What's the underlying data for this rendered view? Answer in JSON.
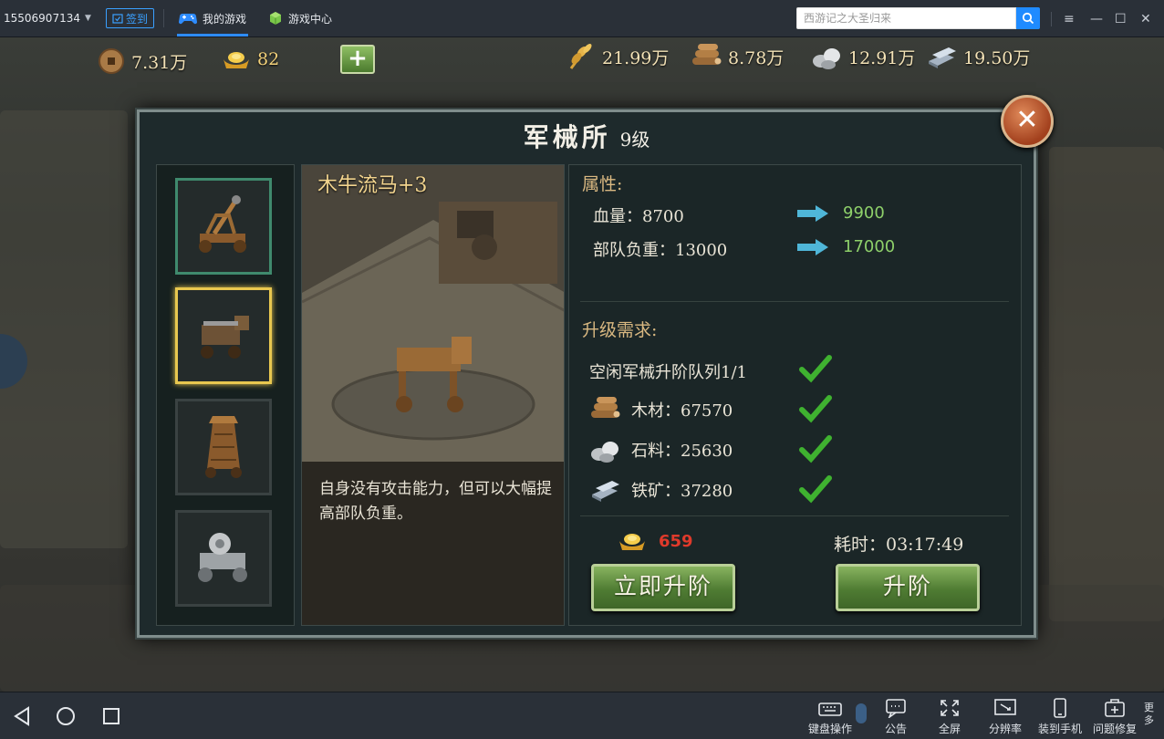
{
  "topbar": {
    "user": "15506907134",
    "checkin": "签到",
    "tabs": [
      {
        "label": "我的游戏"
      },
      {
        "label": "游戏中心"
      }
    ],
    "search_placeholder": "西游记之大圣归来"
  },
  "resources": {
    "copper": "7.31万",
    "ingot": "82",
    "grain": "21.99万",
    "wood": "8.78万",
    "stone": "12.91万",
    "iron": "19.50万"
  },
  "panel": {
    "title": "军械所",
    "level": "9级",
    "item_name": "木牛流马+3",
    "description": "自身没有攻击能力，但可以大幅提高部队负重。",
    "attributes_header": "属性:",
    "attributes": [
      {
        "label": "血量：8700",
        "next": "9900"
      },
      {
        "label": "部队负重：13000",
        "next": "17000"
      }
    ],
    "requirements_header": "升级需求:",
    "requirements": [
      {
        "label": "空闲军械升阶队列1/1"
      },
      {
        "label": "木材：67570",
        "icon": "wood-icon"
      },
      {
        "label": "石料：25630",
        "icon": "stone-icon"
      },
      {
        "label": "铁矿：37280",
        "icon": "iron-icon"
      }
    ],
    "ingot_cost": "659",
    "time": "耗时：03:17:49",
    "instant_button": "立即升阶",
    "upgrade_button": "升阶"
  },
  "bottombar": {
    "tools": [
      {
        "label": "键盘操作"
      },
      {
        "label": "公告"
      },
      {
        "label": "全屏"
      },
      {
        "label": "分辨率"
      },
      {
        "label": "装到手机"
      },
      {
        "label": "问题修复"
      }
    ],
    "more": "更多"
  },
  "colors": {
    "accent": "#1f8bff",
    "highlight_gold": "#e8c74f",
    "next_value_green": "#8ed06a",
    "cost_red": "#e03a2b"
  }
}
